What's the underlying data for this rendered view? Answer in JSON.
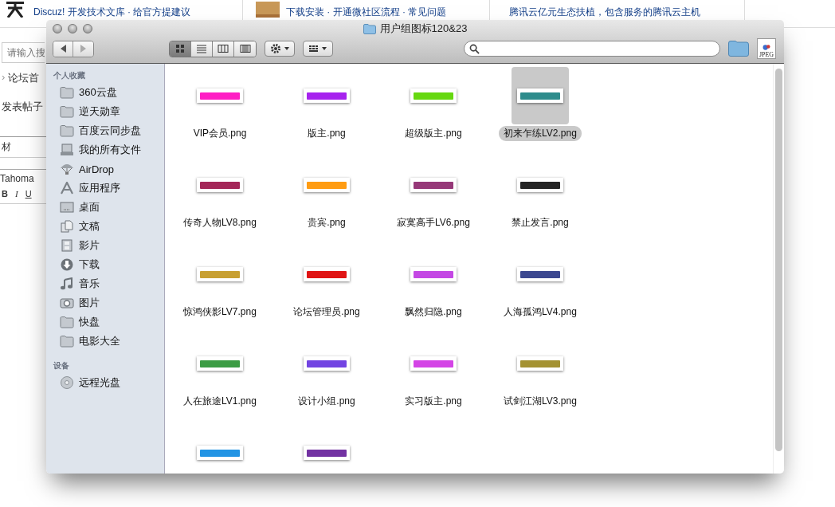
{
  "page": {
    "top_links": [
      "Discuz! 开发技术文库 · 给官方提建议",
      "下载安装 · 开通微社区流程 · 常见问题",
      "腾讯云亿元生态扶植，包含服务的腾讯云主机"
    ],
    "search": {
      "placeholder": "请输入搜"
    },
    "breadcrumb_separator": "›",
    "breadcrumb": "论坛首",
    "post_button": "发表帖子",
    "category": "材",
    "font": "Tahoma",
    "format_buttons": [
      "B",
      "I",
      "U"
    ]
  },
  "window": {
    "title": "用户组图标120&23",
    "views": [
      {
        "kind": "icon",
        "selected": true
      },
      {
        "kind": "list",
        "selected": false
      },
      {
        "kind": "column",
        "selected": false
      },
      {
        "kind": "coverflow",
        "selected": false
      }
    ],
    "file_type_label": "JPEG",
    "sidebar": [
      {
        "header": "个人收藏",
        "items": [
          {
            "label": "360云盘",
            "kind": "folder"
          },
          {
            "label": "逆天勋章",
            "kind": "folder"
          },
          {
            "label": "百度云同步盘",
            "kind": "folder"
          },
          {
            "label": "我的所有文件",
            "kind": "allfiles"
          },
          {
            "label": "AirDrop",
            "kind": "airdrop"
          },
          {
            "label": "应用程序",
            "kind": "apps"
          },
          {
            "label": "桌面",
            "kind": "desktop"
          },
          {
            "label": "文稿",
            "kind": "docs"
          },
          {
            "label": "影片",
            "kind": "movies"
          },
          {
            "label": "下载",
            "kind": "download"
          },
          {
            "label": "音乐",
            "kind": "music"
          },
          {
            "label": "图片",
            "kind": "pictures"
          },
          {
            "label": "快盘",
            "kind": "folder"
          },
          {
            "label": "电影大全",
            "kind": "folder"
          }
        ]
      },
      {
        "header": "设备",
        "items": [
          {
            "label": "远程光盘",
            "kind": "disc"
          }
        ]
      }
    ],
    "files": [
      {
        "name": "VIP会员.png",
        "color": "#ff1ec4",
        "selected": false
      },
      {
        "name": "版主.png",
        "color": "#a622ee",
        "selected": false
      },
      {
        "name": "超级版主.png",
        "color": "#66d810",
        "selected": false
      },
      {
        "name": "初来乍练LV2.png",
        "color": "#2e8c8c",
        "selected": true
      },
      {
        "name": "传奇人物LV8.png",
        "color": "#a42658",
        "selected": false
      },
      {
        "name": "贵宾.png",
        "color": "#ff9c12",
        "selected": false
      },
      {
        "name": "寂寞高手LV6.png",
        "color": "#963878",
        "selected": false
      },
      {
        "name": "禁止发言.png",
        "color": "#242424",
        "selected": false
      },
      {
        "name": "惊鸿侠影LV7.png",
        "color": "#c8a032",
        "selected": false
      },
      {
        "name": "论坛管理员.png",
        "color": "#e01414",
        "selected": false
      },
      {
        "name": "飘然归隐.png",
        "color": "#c448e4",
        "selected": false
      },
      {
        "name": "人海孤鸿LV4.png",
        "color": "#3c4890",
        "selected": false
      },
      {
        "name": "人在旅途LV1.png",
        "color": "#3c9c44",
        "selected": false
      },
      {
        "name": "设计小组.png",
        "color": "#7244e2",
        "selected": false
      },
      {
        "name": "实习版主.png",
        "color": "#d444e6",
        "selected": false
      },
      {
        "name": "试剑江湖LV3.png",
        "color": "#a49232",
        "selected": false
      },
      {
        "color": "#2294e4",
        "selected": false
      },
      {
        "color": "#7232a2",
        "selected": false
      }
    ]
  }
}
